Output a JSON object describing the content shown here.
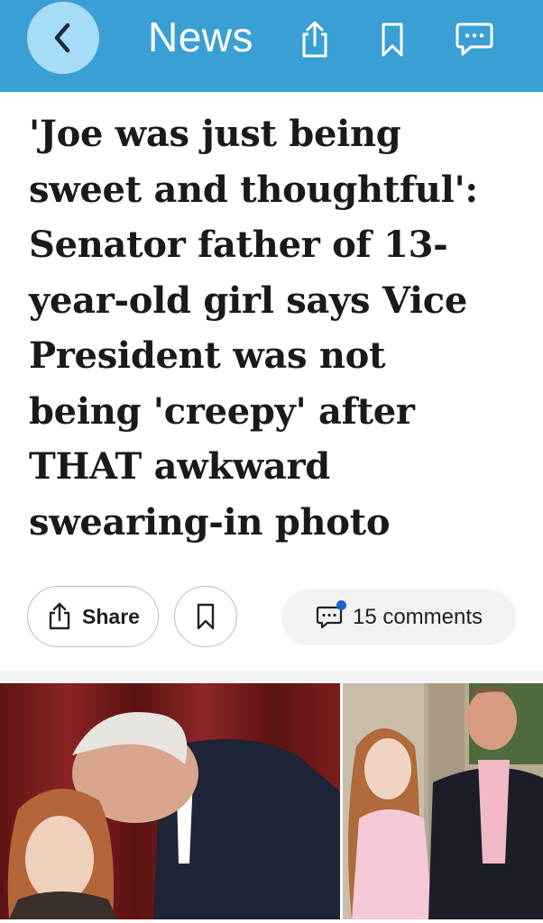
{
  "header": {
    "title": "News",
    "icons": [
      "back-icon",
      "share-icon",
      "bookmark-icon",
      "comment-icon"
    ]
  },
  "article": {
    "headline_lines": [
      "'Joe was just being",
      "sweet and thoughtful':",
      "Senator father of 13-",
      "year-old girl says Vice",
      "President was not",
      "being 'creepy' after",
      "THAT awkward",
      "swearing-in photo"
    ]
  },
  "actions": {
    "share_label": "Share",
    "comments_label": "15 comments"
  },
  "colors": {
    "header_bg": "#3a9fd4",
    "back_button_bg": "#a6dcf7",
    "notification_dot": "#1f5fd1"
  }
}
